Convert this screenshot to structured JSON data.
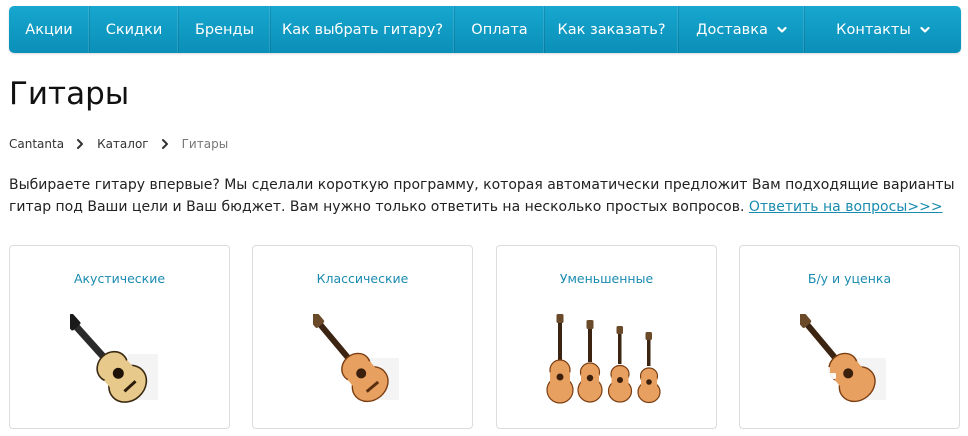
{
  "nav": {
    "items": [
      {
        "label": "Акции",
        "dropdown": false
      },
      {
        "label": "Скидки",
        "dropdown": false
      },
      {
        "label": "Бренды",
        "dropdown": false
      },
      {
        "label": "Как выбрать гитару?",
        "dropdown": false
      },
      {
        "label": "Оплата",
        "dropdown": false
      },
      {
        "label": "Как заказать?",
        "dropdown": false
      },
      {
        "label": "Доставка",
        "dropdown": true
      },
      {
        "label": "Контакты",
        "dropdown": true
      }
    ]
  },
  "page": {
    "title": "Гитары"
  },
  "breadcrumb": {
    "items": [
      "Cantanta",
      "Каталог",
      "Гитары"
    ]
  },
  "intro": {
    "text": "Выбираете гитару впервые? Мы сделали короткую программу, которая автоматически предложит Вам подходящие варианты гитар под Ваши цели и Ваш бюджет. Вам нужно только ответить на несколько простых вопросов. ",
    "link_label": "Ответить на вопросы>>>"
  },
  "categories": [
    {
      "label": "Акустические",
      "icon": "acoustic-guitar-icon"
    },
    {
      "label": "Классические",
      "icon": "classical-guitar-icon"
    },
    {
      "label": "Уменьшенные",
      "icon": "reduced-guitars-icon"
    },
    {
      "label": "Б/у и уценка",
      "icon": "used-guitar-icon"
    }
  ],
  "colors": {
    "nav_background": "#0f9bc4",
    "link": "#1a8bb0",
    "card_border": "#dcdcdc"
  }
}
